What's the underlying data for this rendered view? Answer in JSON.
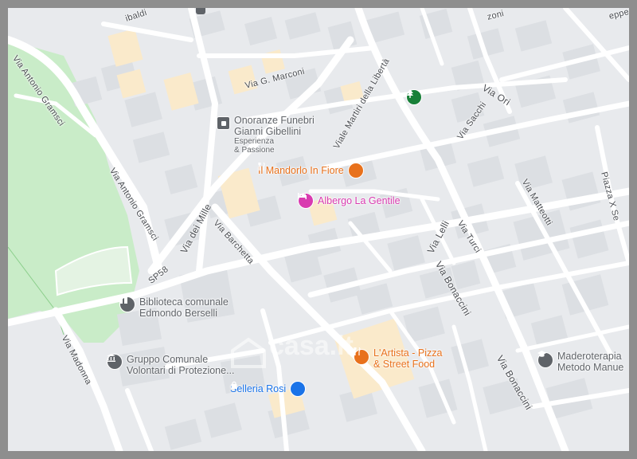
{
  "colors": {
    "background": "#e8eaed",
    "park": "#c9ecc8",
    "road": "#ffffff",
    "building": "#dcdfe3",
    "highlight_building": "#faeacb",
    "poi_gray": "#5f6368",
    "poi_orange": "#e8711c",
    "poi_pink": "#d93bb0",
    "poi_blue": "#1a73e8",
    "park_icon": "#188038",
    "frame": "#8e8e8e"
  },
  "streets": {
    "garibaldi": "ibaldi",
    "marconi": "Via G. Marconi",
    "liberta": "Viale Martiri della Libertà",
    "ori": "Via Ori",
    "sacchi": "Via Sacchi",
    "zoni": "zoni",
    "deppe": "eppe",
    "gramsci_1": "Via Antonio Gramsci",
    "gramsci_2": "Via Antonio Gramsci",
    "dei_mille": "Via dei Mille",
    "barchetta": "Via Barchetta",
    "sp58": "SP58",
    "lelli": "Via Lelli",
    "turci": "Via Turci",
    "matteotti": "Via Matteotti",
    "piazza": "Piazza X Se",
    "bonaccini_1": "Via Bonaccini",
    "bonaccini_2": "Via Bonaccini",
    "madonna": "Via Madonna"
  },
  "pois": {
    "onoranze": {
      "line1": "Onoranze Funebri",
      "line2": "Gianni Gibellini",
      "sub1": "Esperienza",
      "sub2": "& Passione",
      "icon": "square-marker-icon"
    },
    "mandorlo": {
      "label": "Il Mandorlo In Fiore",
      "icon": "restaurant-icon"
    },
    "albergo": {
      "label": "Albergo La Gentile",
      "icon": "hotel-icon"
    },
    "biblioteca": {
      "line1": "Biblioteca comunale",
      "line2": "Edmondo Berselli",
      "icon": "library-icon"
    },
    "gruppo": {
      "line1": "Gruppo Comunale",
      "line2": "Volontari di Protezione...",
      "icon": "government-icon"
    },
    "artista": {
      "line1": "L'Artista - Pizza",
      "line2": "& Street Food",
      "icon": "restaurant-icon"
    },
    "selleria": {
      "label": "Selleria Rosi",
      "icon": "shopping-bag-icon"
    },
    "madero": {
      "line1": "Maderoterapia",
      "line2": "Metodo Manue",
      "icon": "education-icon"
    },
    "park": {
      "icon": "tree-icon"
    }
  },
  "watermark": "casa.it"
}
